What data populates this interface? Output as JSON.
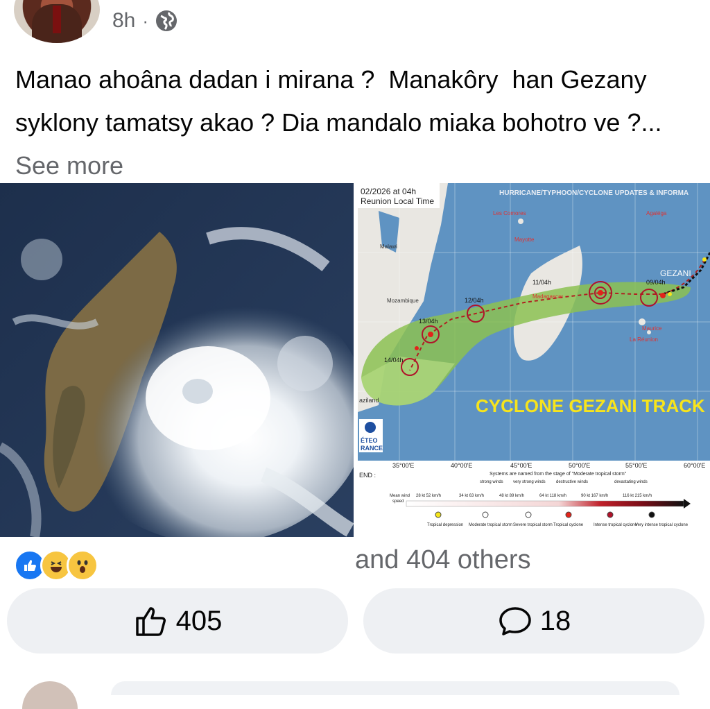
{
  "post": {
    "time": "8h",
    "separator": "·",
    "audience_icon": "globe-icon",
    "text": "Manao ahoâna dadan i mirana ?  Manakôry  han Gezany syklony tamatsy akao ? Dia mandalo miaka bohotro ve ?... ",
    "see_more": "See more"
  },
  "map": {
    "header_date": "02/2026 at 04h",
    "header_tz": "Reunion Local Time",
    "header_title": "HURRICANE/TYPHOON/CYCLONE UPDATES & INFORMA",
    "labels": {
      "comores": "Les Comores",
      "mayotte": "Mayotte",
      "agalega": "Agaléga",
      "malawi": "Malawi",
      "mozambique": "Mozambique",
      "madagascar": "Madagascar",
      "maurice": "Maurice",
      "reunion": "La Réunion",
      "gezani": "GEZANI",
      "swaziland": "aziland",
      "meteo1": "ÉTEO",
      "meteo2": "RANCE"
    },
    "track_title": "CYCLONE GEZANI TRACK",
    "dates": [
      "09/04h",
      "11/04h",
      "12/04h",
      "13/04h",
      "14/04h"
    ],
    "longitudes": [
      "35°00'E",
      "40°00'E",
      "45°00'E",
      "50°00'E",
      "55°00'E",
      "60°00'E"
    ],
    "legend": {
      "title": "END :",
      "naming_note": "Systems are named from the stage of \"Moderate tropical storm\"",
      "mean_wind_1": "Mean wind",
      "mean_wind_2": "speed",
      "wind_categories": [
        "strong winds",
        "very strong winds",
        "destructive winds",
        "devastating winds"
      ],
      "speeds": [
        "28 kt 52 km/h",
        "34 kt 63 km/h",
        "48 kt 89 km/h",
        "64 kt 118 km/h",
        "90 kt 167 km/h",
        "116 kt 215 km/h"
      ],
      "stages": [
        "Tropical depression",
        "Moderate tropical storm",
        "Severe tropical storm",
        "Tropical cyclone",
        "Intense tropical cyclone",
        "Very intense tropical cyclone"
      ],
      "stage_colors": [
        "#f5e51b",
        "#ffffff",
        "#ffffff",
        "#e2231a",
        "#b0132a",
        "#111111"
      ]
    }
  },
  "reactions": {
    "icons": [
      "like-reaction-icon",
      "haha-reaction-icon",
      "wow-reaction-icon"
    ],
    "summary": "and 404 others"
  },
  "actions": {
    "like_count": "405",
    "comment_count": "18"
  },
  "colors": {
    "secondary_text": "#65676b",
    "button_bg": "#eef0f3",
    "like_blue": "#1877f2",
    "track_green": "#8cc152",
    "title_yellow": "#f7e41c"
  }
}
